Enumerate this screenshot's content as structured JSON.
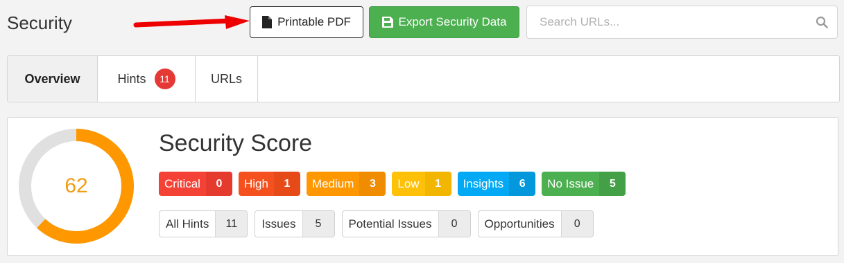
{
  "header": {
    "title": "Security",
    "pdf_button": "Printable PDF",
    "export_button": "Export Security Data",
    "search_placeholder": "Search URLs..."
  },
  "tabs": [
    {
      "label": "Overview",
      "active": true
    },
    {
      "label": "Hints",
      "badge": "11"
    },
    {
      "label": "URLs"
    }
  ],
  "score": {
    "title": "Security Score",
    "value": "62",
    "fraction": 0.62,
    "ring_color": "#ff9800",
    "track_color": "#e0e0e0"
  },
  "severities": [
    {
      "label": "Critical",
      "count": "0",
      "color": "#f44336",
      "dark": "#e53a2e"
    },
    {
      "label": "High",
      "count": "1",
      "color": "#f4511e",
      "dark": "#e64a19"
    },
    {
      "label": "Medium",
      "count": "3",
      "color": "#ff9800",
      "dark": "#ef8c00"
    },
    {
      "label": "Low",
      "count": "1",
      "color": "#ffc107",
      "dark": "#f2b500"
    },
    {
      "label": "Insights",
      "count": "6",
      "color": "#03a9f4",
      "dark": "#0398dc"
    },
    {
      "label": "No Issue",
      "count": "5",
      "color": "#4caf50",
      "dark": "#43a047"
    }
  ],
  "counts": [
    {
      "label": "All Hints",
      "count": "11"
    },
    {
      "label": "Issues",
      "count": "5"
    },
    {
      "label": "Potential Issues",
      "count": "0"
    },
    {
      "label": "Opportunities",
      "count": "0"
    }
  ]
}
